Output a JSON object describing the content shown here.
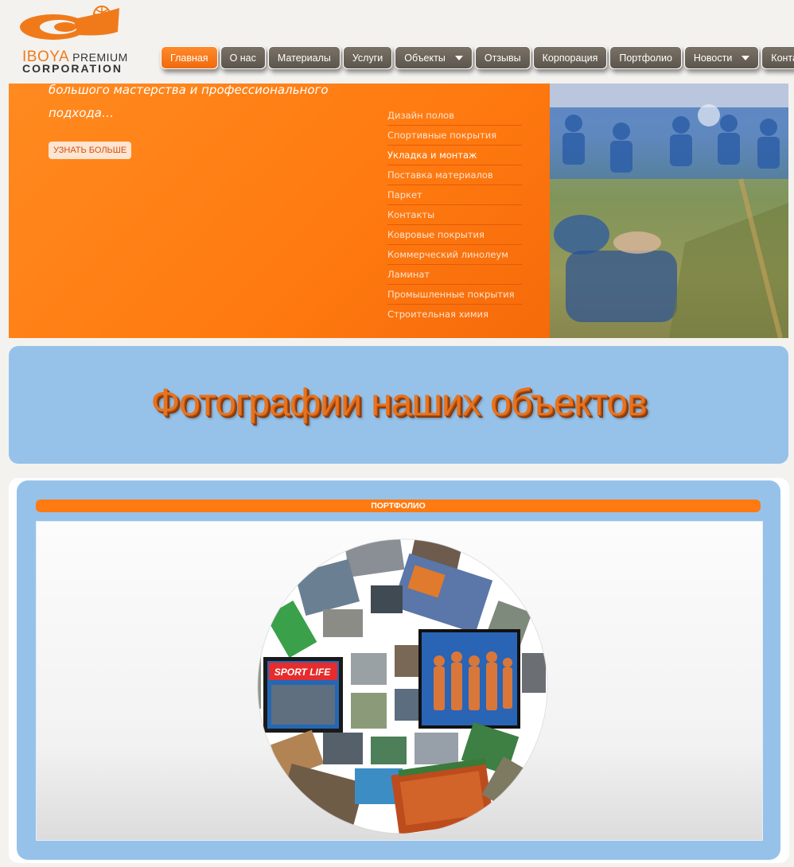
{
  "logo": {
    "brand": "IBOYA",
    "premium": "PREMIUM",
    "corporation": "CORPORATION"
  },
  "nav": {
    "items": [
      {
        "label": "Главная",
        "active": true,
        "dropdown": false
      },
      {
        "label": "О нас",
        "active": false,
        "dropdown": false
      },
      {
        "label": "Материалы",
        "active": false,
        "dropdown": false
      },
      {
        "label": "Услуги",
        "active": false,
        "dropdown": false
      },
      {
        "label": "Объекты",
        "active": false,
        "dropdown": true
      },
      {
        "label": "Отзывы",
        "active": false,
        "dropdown": false
      },
      {
        "label": "Корпорация",
        "active": false,
        "dropdown": false
      },
      {
        "label": "Портфолио",
        "active": false,
        "dropdown": false
      },
      {
        "label": "Новости",
        "active": false,
        "dropdown": true
      },
      {
        "label": "Контакты",
        "active": false,
        "dropdown": false
      }
    ]
  },
  "hero": {
    "slogan_line1": "большого мастерства и профессионального",
    "slogan_line2": "подхода…",
    "button_label": "УЗНАТЬ БОЛЬШЕ",
    "menu": [
      "Дизайн полов",
      "Спортивные покрытия",
      "Укладка и монтаж",
      "Поставка материалов",
      "Паркет",
      "Контакты",
      "Ковровые покрытия",
      "Коммерческий линолеум",
      "Ламинат",
      "Промышленные покрытия",
      "Строительная химия"
    ],
    "menu_current": 2
  },
  "banner": {
    "title": "Фотографии наших объектов"
  },
  "portfolio": {
    "header": "ПОРТФОЛИО",
    "sport_life_sign": "SPORT LIFE"
  },
  "colors": {
    "accent_orange": "#ff7a10",
    "nav_gray": "#6b6359",
    "panel_blue": "#96c2ea"
  }
}
